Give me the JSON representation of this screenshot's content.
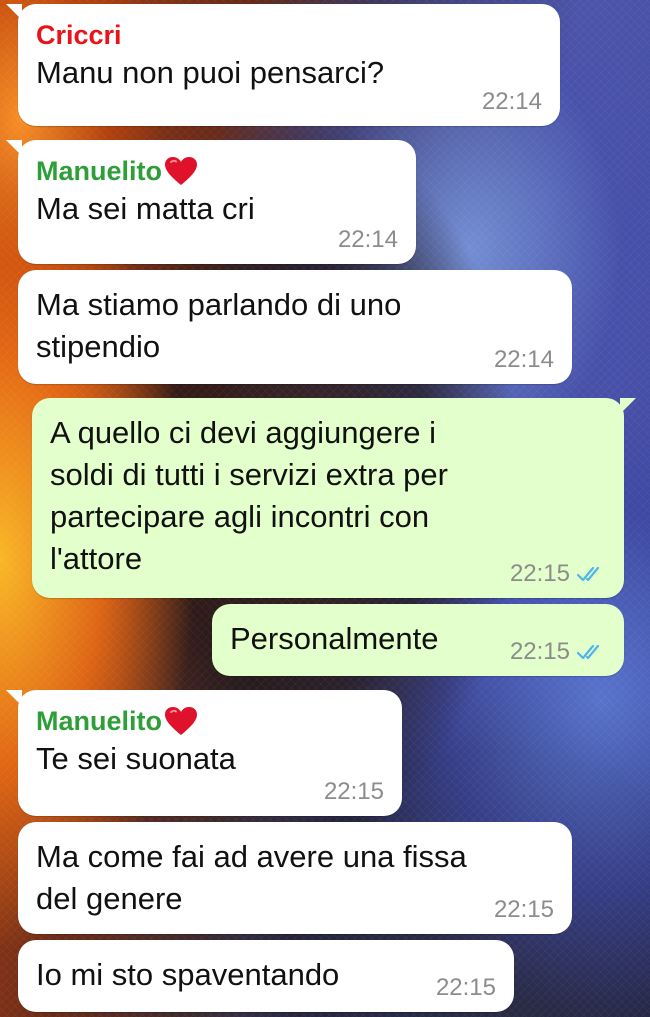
{
  "chat": {
    "colors": {
      "incoming_bubble": "#ffffff",
      "outgoing_bubble": "#e3ffcb",
      "sender_criccri": "#e8141a",
      "sender_manuelito": "#2e9e38",
      "time": "#8c8c8c",
      "read_ticks": "#4fb6ec"
    },
    "messages": [
      {
        "sender": "Criccri",
        "text": "Manu non puoi pensarci?",
        "time": "22:14"
      },
      {
        "sender": "Manuelito",
        "sender_icon": "red-heart-icon",
        "text": "Ma sei matta cri",
        "time": "22:14"
      },
      {
        "text_lines": [
          "Ma stiamo parlando di uno",
          "stipendio"
        ],
        "time": "22:14"
      },
      {
        "text_lines": [
          "A quello ci devi aggiungere i",
          "soldi di tutti i servizi extra per",
          "partecipare agli incontri con",
          "l'attore"
        ],
        "time": "22:15",
        "status_icon": "double-check-read-icon"
      },
      {
        "text": "Personalmente",
        "time": "22:15",
        "status_icon": "double-check-read-icon"
      },
      {
        "sender": "Manuelito",
        "sender_icon": "red-heart-icon",
        "text": "Te sei suonata",
        "time": "22:15"
      },
      {
        "text_lines": [
          "Ma come fai ad avere una fissa",
          "del genere"
        ],
        "time": "22:15"
      },
      {
        "text": "Io mi sto spaventando",
        "time": "22:15"
      }
    ]
  }
}
